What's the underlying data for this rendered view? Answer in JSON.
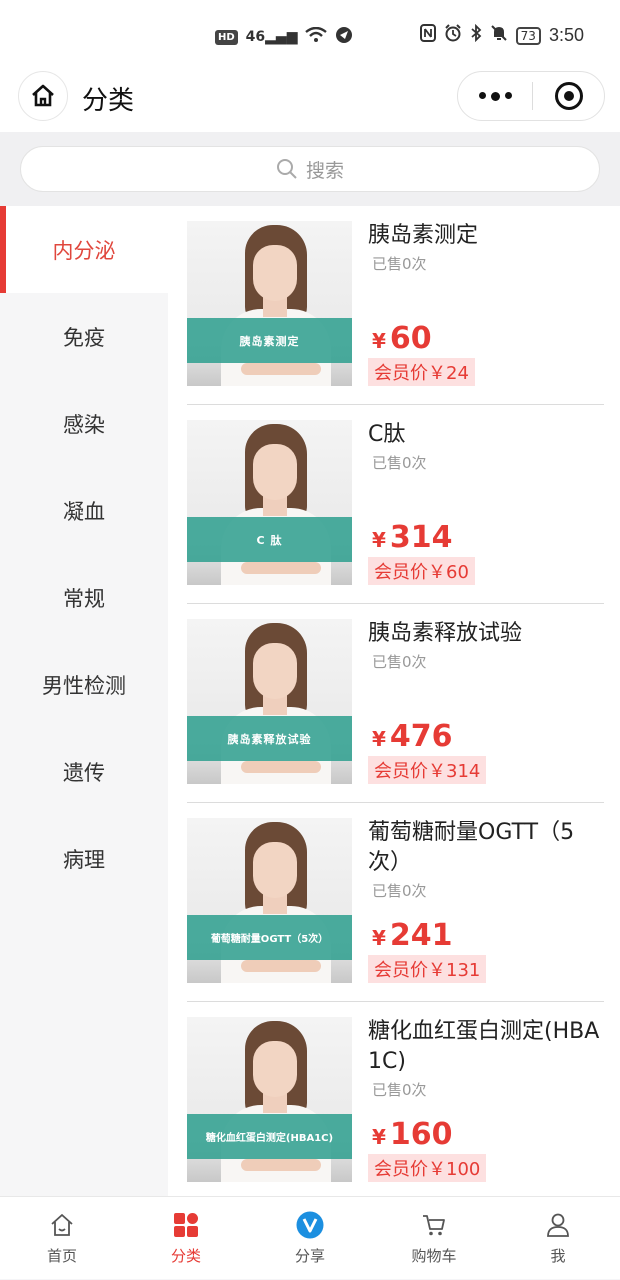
{
  "status_bar": {
    "time": "3:50",
    "battery": "73",
    "network": "HD",
    "signal": "46"
  },
  "nav": {
    "title": "分类"
  },
  "search": {
    "placeholder": "搜索"
  },
  "sidebar": {
    "items": [
      {
        "label": "内分泌",
        "active": true
      },
      {
        "label": "免疫"
      },
      {
        "label": "感染"
      },
      {
        "label": "凝血"
      },
      {
        "label": "常规"
      },
      {
        "label": "男性检测"
      },
      {
        "label": "遗传"
      },
      {
        "label": "病理"
      }
    ]
  },
  "products": [
    {
      "title": "胰岛素测定",
      "banner": "胰岛素测定",
      "sold": "已售0次",
      "currency": "¥",
      "price": "60",
      "member": "会员价￥24"
    },
    {
      "title": "C肽",
      "banner": "C 肽",
      "sold": "已售0次",
      "currency": "¥",
      "price": "314",
      "member": "会员价￥60"
    },
    {
      "title": "胰岛素释放试验",
      "banner": "胰岛素释放试验",
      "sold": "已售0次",
      "currency": "¥",
      "price": "476",
      "member": "会员价￥314"
    },
    {
      "title": "葡萄糖耐量OGTT（5次）",
      "banner": "葡萄糖耐量OGTT（5次）",
      "sold": "已售0次",
      "currency": "¥",
      "price": "241",
      "member": "会员价￥131"
    },
    {
      "title": "糖化血红蛋白测定(HBA1C)",
      "banner": "糖化血红蛋白测定(HBA1C)",
      "sold": "已售0次",
      "currency": "¥",
      "price": "160",
      "member": "会员价￥100"
    }
  ],
  "tabbar": {
    "items": [
      {
        "label": "首页",
        "icon": "home-icon"
      },
      {
        "label": "分类",
        "icon": "category-icon",
        "active": true
      },
      {
        "label": "分享",
        "icon": "share-v-icon"
      },
      {
        "label": "购物车",
        "icon": "cart-icon"
      },
      {
        "label": "我",
        "icon": "user-icon"
      }
    ]
  },
  "colors": {
    "accent": "#e63b35",
    "banner": "#32a091",
    "member_bg": "#fde0e0"
  }
}
